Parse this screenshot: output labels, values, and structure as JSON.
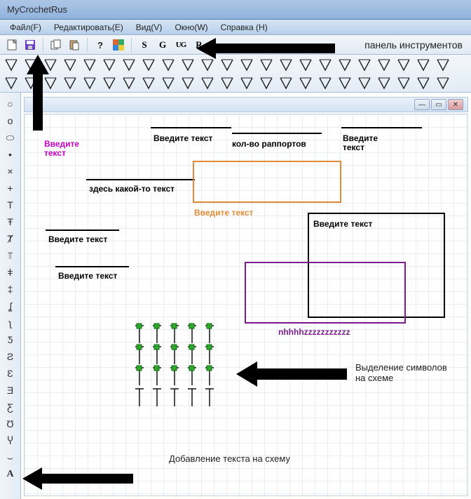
{
  "window": {
    "title": "MyCrochetRus"
  },
  "menu": {
    "file": "Файл(F)",
    "edit": "Редактировать(E)",
    "view": "Вид(V)",
    "window": "Окно(W)",
    "help": "Справка (H)"
  },
  "toolbar": {
    "panel_label": "панель инструментов",
    "icons": {
      "new": "new-file",
      "save": "save",
      "copy": "copy",
      "paste": "paste",
      "help": "help",
      "colorgrid": "color-grid",
      "s": "S",
      "g": "G",
      "ug": "UG",
      "r": "R"
    }
  },
  "left_palette_text_tool": "A",
  "doc_win": {
    "min": "—",
    "max": "▭",
    "close": "✕"
  },
  "labels": {
    "vved1": "Введите\nтекст",
    "vved2": "Введите текст",
    "vved3": "Введите\nтекст",
    "vved4": "Введите текст",
    "vved5": "Введите текст",
    "vved6": "Введите текст",
    "some_text": "здесь какой-то текст",
    "rapports": "кол-во раппортов",
    "orange_label": "Введите текст",
    "nhz": "nhhhhzzzzzzzzzzz"
  },
  "annotations": {
    "selection": "Выделение символов\nна схеме",
    "add_text": "Добавление текста на схему"
  },
  "colors": {
    "magenta": "#c400c4",
    "orange": "#e28b36",
    "purple": "#7a1e8c",
    "blue": "#1030d0"
  }
}
